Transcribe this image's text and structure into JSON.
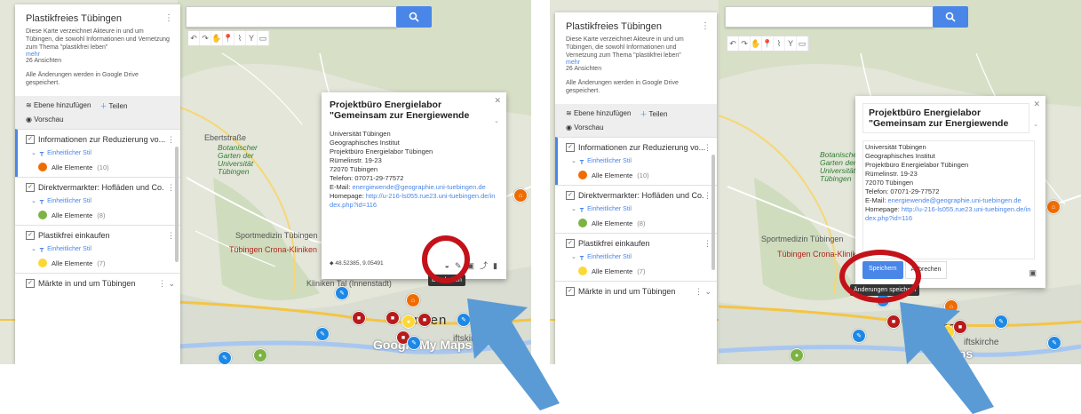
{
  "left": {
    "panel": {
      "title": "Plastikfreies Tübingen",
      "description": "Diese Karte verzeichnet Akteure in und um Tübingen, die sowohl Informationen und Vernetzung zum Thema \"plastikfrei leben\"",
      "more": "mehr",
      "views": "26 Ansichten",
      "saved": "Alle Änderungen werden in Google Drive gespeichert.",
      "add_layer": "Ebene hinzufügen",
      "share": "Teilen",
      "preview": "Vorschau",
      "layers": [
        {
          "title": "Informationen zur Reduzierung vo...",
          "style": "Einheitlicher Stil",
          "elements": "Alle Elemente",
          "count": "(10)",
          "color": "#ef6c00"
        },
        {
          "title": "Direktvermarkter: Hofläden und Co.",
          "style": "Einheitlicher Stil",
          "elements": "Alle Elemente",
          "count": "(8)",
          "color": "#7cb342"
        },
        {
          "title": "Plastikfrei einkaufen",
          "style": "Einheitlicher Stil",
          "elements": "Alle Elemente",
          "count": "(7)",
          "color": "#fdd835"
        },
        {
          "title": "Märkte in und um Tübingen"
        }
      ]
    },
    "popup": {
      "title": "Projektbüro Energielabor \"Gemeinsam zur Energiewende",
      "lines": [
        "Universität Tübingen",
        "Geographisches Institut",
        "Projektbüro Energielabor Tübingen",
        "Rümelinstr. 19-23",
        "72070 Tübingen",
        "Telefon: 07071-29-77572"
      ],
      "email_label": "E-Mail:",
      "email": "energiewende@geographie.uni-tuebingen.de",
      "homepage_label": "Homepage:",
      "homepage": "http://u-216-ls055.rue23.uni-tuebingen.de/index.php?id=116",
      "coords": "48.52385, 9.05491",
      "tooltip": "Bearbeiten"
    },
    "map_labels": {
      "garden": "Botanischer Garten der Universität Tübingen",
      "sport": "Sportmedizin Tübingen",
      "clinic": "Tübingen Crona-Kliniken",
      "clinic_inner": "Kliniken Tal (Innenstadt)",
      "town": "ngen",
      "church": "iftskirche",
      "ebers": "Ebertstraße",
      "logo": "Google My Maps"
    }
  },
  "right": {
    "panel": {
      "title": "Plastikfreies Tübingen",
      "description": "Diese Karte verzeichnet Akteure in und um Tübingen, die sowohl Informationen und Vernetzung zum Thema \"plastikfrei leben\"",
      "more": "mehr",
      "views": "26 Ansichten",
      "saved": "Alle Änderungen werden in Google Drive gespeichert.",
      "add_layer": "Ebene hinzufügen",
      "share": "Teilen",
      "preview": "Vorschau",
      "layers": [
        {
          "title": "Informationen zur Reduzierung vo...",
          "style": "Einheitlicher Stil",
          "elements": "Alle Elemente",
          "count": "(10)",
          "color": "#ef6c00"
        },
        {
          "title": "Direktvermarkter: Hofläden und Co.",
          "style": "Einheitlicher Stil",
          "elements": "Alle Elemente",
          "count": "(8)",
          "color": "#7cb342"
        },
        {
          "title": "Plastikfrei einkaufen",
          "style": "Einheitlicher Stil",
          "elements": "Alle Elemente",
          "count": "(7)",
          "color": "#fdd835"
        },
        {
          "title": "Märkte in und um Tübingen"
        }
      ]
    },
    "popup": {
      "title": "Projektbüro Energielabor \"Gemeinsam zur Energiewende",
      "lines": [
        "Universität Tübingen",
        "Geographisches Institut",
        "Projektbüro Energielabor Tübingen",
        "Rümelinstr. 19-23",
        "72070 Tübingen",
        "Telefon: 07071-29-77572"
      ],
      "email_label": "E-Mail:",
      "email": "energiewende@geographie.uni-tuebingen.de",
      "homepage_label": "Homepage:",
      "homepage": "http://u-216-ls055.rue23.uni-tuebingen.de/index.php?id=116",
      "save": "Speichern",
      "cancel": "Abbrechen",
      "tooltip": "Änderungen speichern"
    },
    "map_labels": {
      "garden": "Botanischer Garten der Universität Tübingen",
      "sport": "Sportmedizin Tübingen",
      "clinic": "Tübingen Crona-Kliniken",
      "town": "ngen",
      "church": "iftskirche",
      "logo": "aps"
    }
  },
  "colors": {
    "accent": "#4a86e8",
    "highlight_ring": "#c4121a",
    "arrow": "#5b9bd5"
  }
}
